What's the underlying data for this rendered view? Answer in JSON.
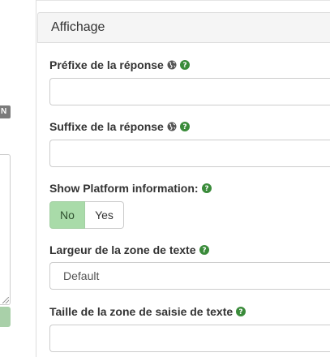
{
  "left_column": {
    "badge_text": "N"
  },
  "panel": {
    "title": "Affichage",
    "fields": {
      "prefix": {
        "label": "Préfixe de la réponse",
        "value": ""
      },
      "suffix": {
        "label": "Suffixe de la réponse",
        "value": ""
      },
      "platform_info": {
        "label": "Show Platform information:",
        "options": [
          "No",
          "Yes"
        ],
        "selected": "No"
      },
      "text_width": {
        "label": "Largeur de la zone de texte",
        "value": "Default"
      },
      "input_size": {
        "label": "Taille de la zone de saisie de texte",
        "value": ""
      }
    }
  },
  "colors": {
    "help_icon": "#3a8b3a",
    "active_button": "#a9dba9",
    "globe_icon": "#555555"
  }
}
